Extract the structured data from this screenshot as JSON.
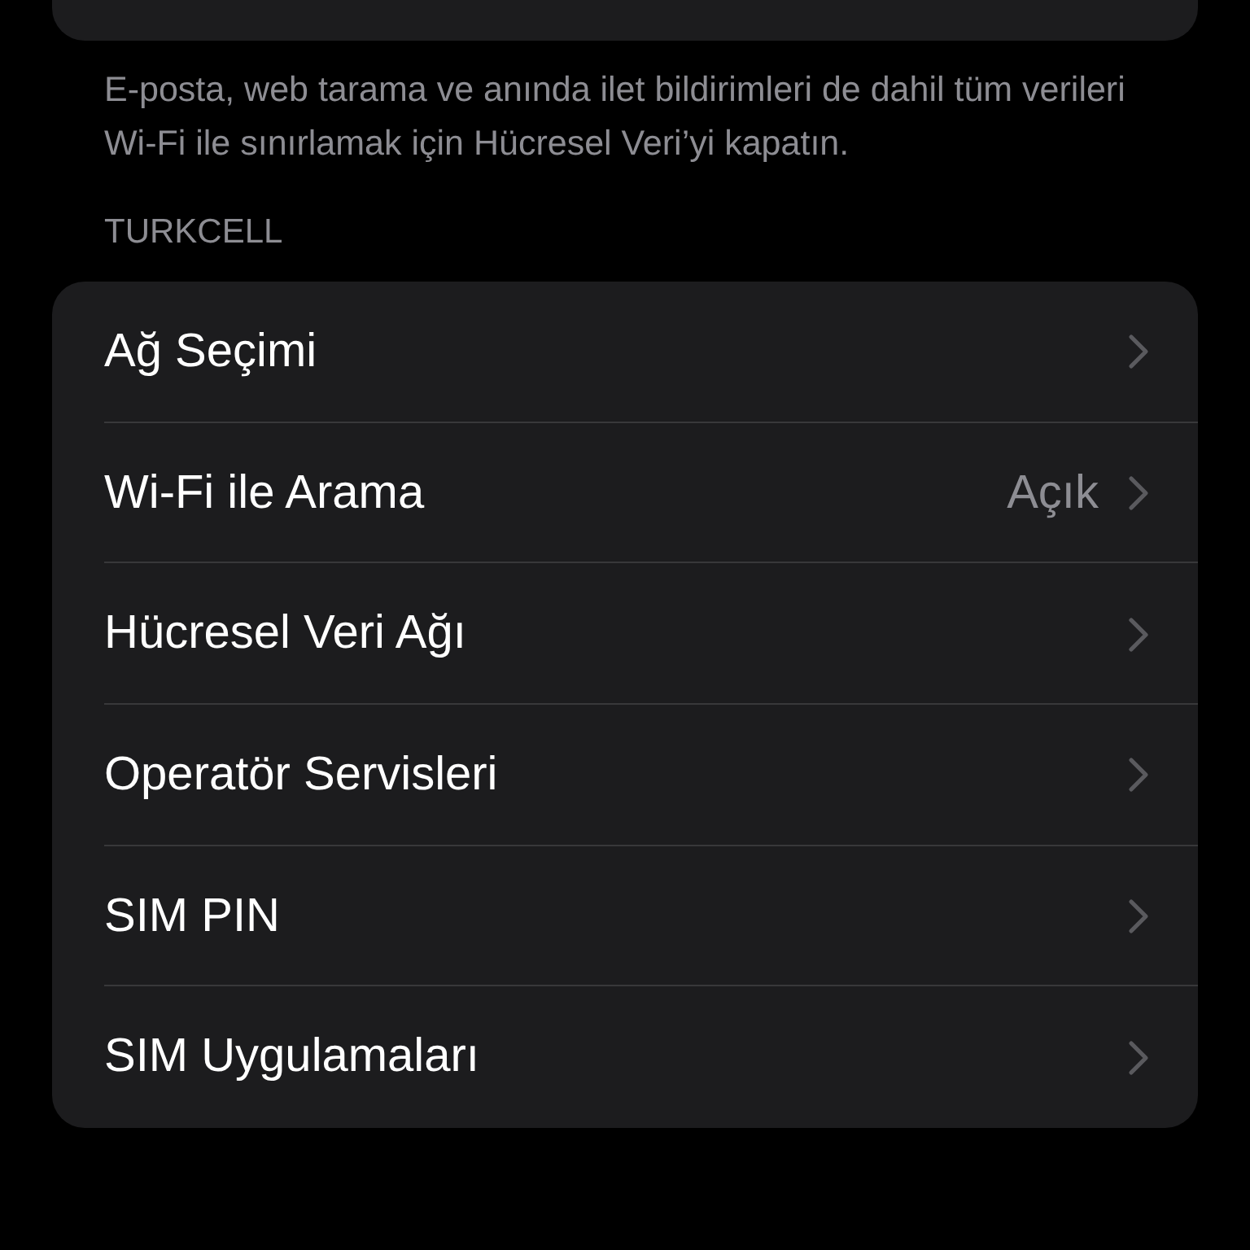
{
  "note": "E-posta, web tarama ve anında ilet bildirimleri de dahil tüm verileri Wi-Fi ile sınırlamak için Hücresel Veri’yi kapatın.",
  "section": {
    "header": "TURKCELL",
    "rows": [
      {
        "label": "Ağ Seçimi"
      },
      {
        "label": "Wi-Fi ile Arama",
        "value": "Açık"
      },
      {
        "label": "Hücresel Veri Ağı"
      },
      {
        "label": "Operatör Servisleri"
      },
      {
        "label": "SIM PIN"
      },
      {
        "label": "SIM Uygulamaları"
      }
    ]
  }
}
